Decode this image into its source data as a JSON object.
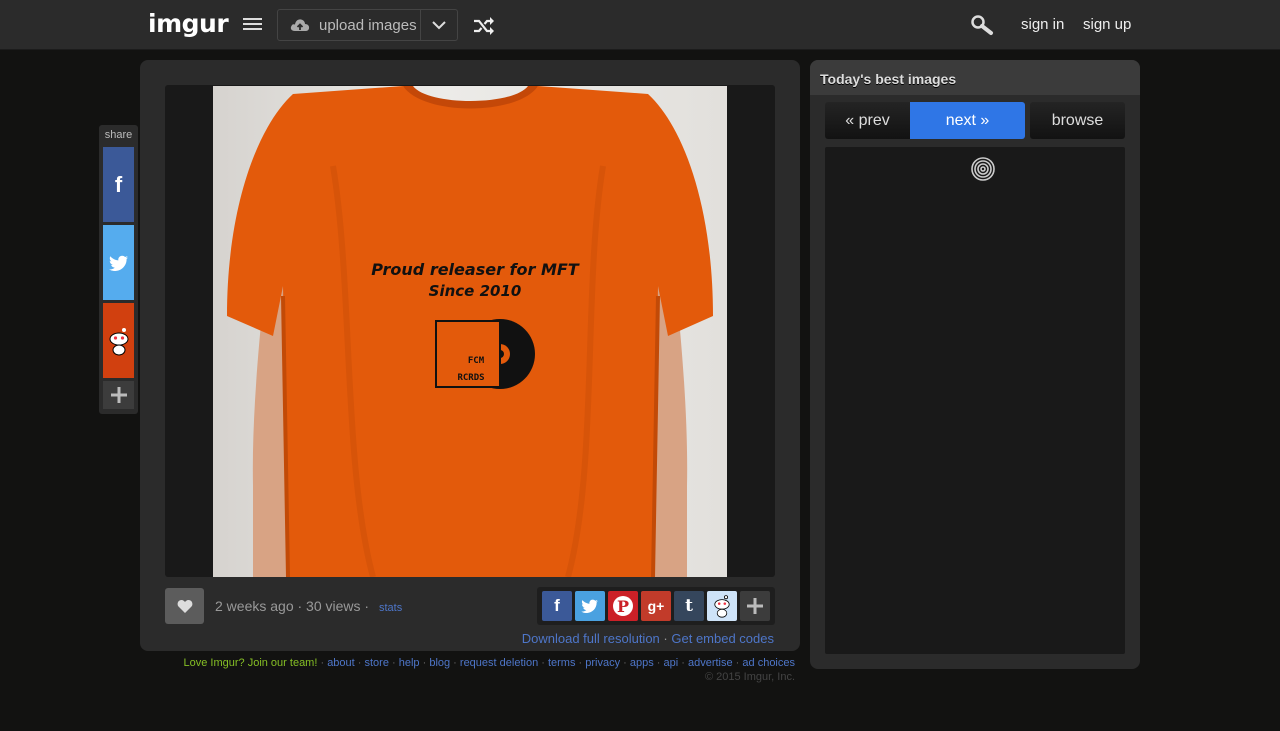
{
  "header": {
    "logo_text": "imgur",
    "upload_label": "upload images",
    "sign_in": "sign in",
    "sign_up": "sign up"
  },
  "share_rail": {
    "label": "share",
    "buttons": [
      "facebook-icon",
      "twitter-icon",
      "reddit-icon",
      "plus-icon"
    ]
  },
  "image": {
    "shirt_line1": "Proud releaser for MFT",
    "shirt_line2": "Since 2010",
    "logo_line1": "FCM",
    "logo_line2": "RCRDS"
  },
  "meta": {
    "posted": "2 weeks ago · 30 views ·",
    "stats_label": "stats",
    "download_label": "Download full resolution",
    "separator": "·",
    "embed_label": "Get embed codes"
  },
  "share_row": {
    "google_label": "g+",
    "tumblr_label": "t",
    "buttons": [
      "facebook-icon",
      "twitter-icon",
      "pinterest-icon",
      "google-plus-icon",
      "tumblr-icon",
      "reddit-icon",
      "plus-icon"
    ]
  },
  "sidebar": {
    "title": "Today's best images",
    "prev": "« prev",
    "next": "next »",
    "browse": "browse"
  },
  "footer": {
    "join": "Love Imgur? Join our team!",
    "links": [
      "about",
      "store",
      "help",
      "blog",
      "request deletion",
      "terms",
      "privacy",
      "apps",
      "api",
      "advertise",
      "ad choices"
    ],
    "copyright": "© 2015 Imgur, Inc."
  },
  "colors": {
    "accent_blue": "#2f76e6",
    "brand_green": "#85bf25",
    "link_blue": "#4e76c9",
    "shirt_orange": "#e35a0b"
  }
}
